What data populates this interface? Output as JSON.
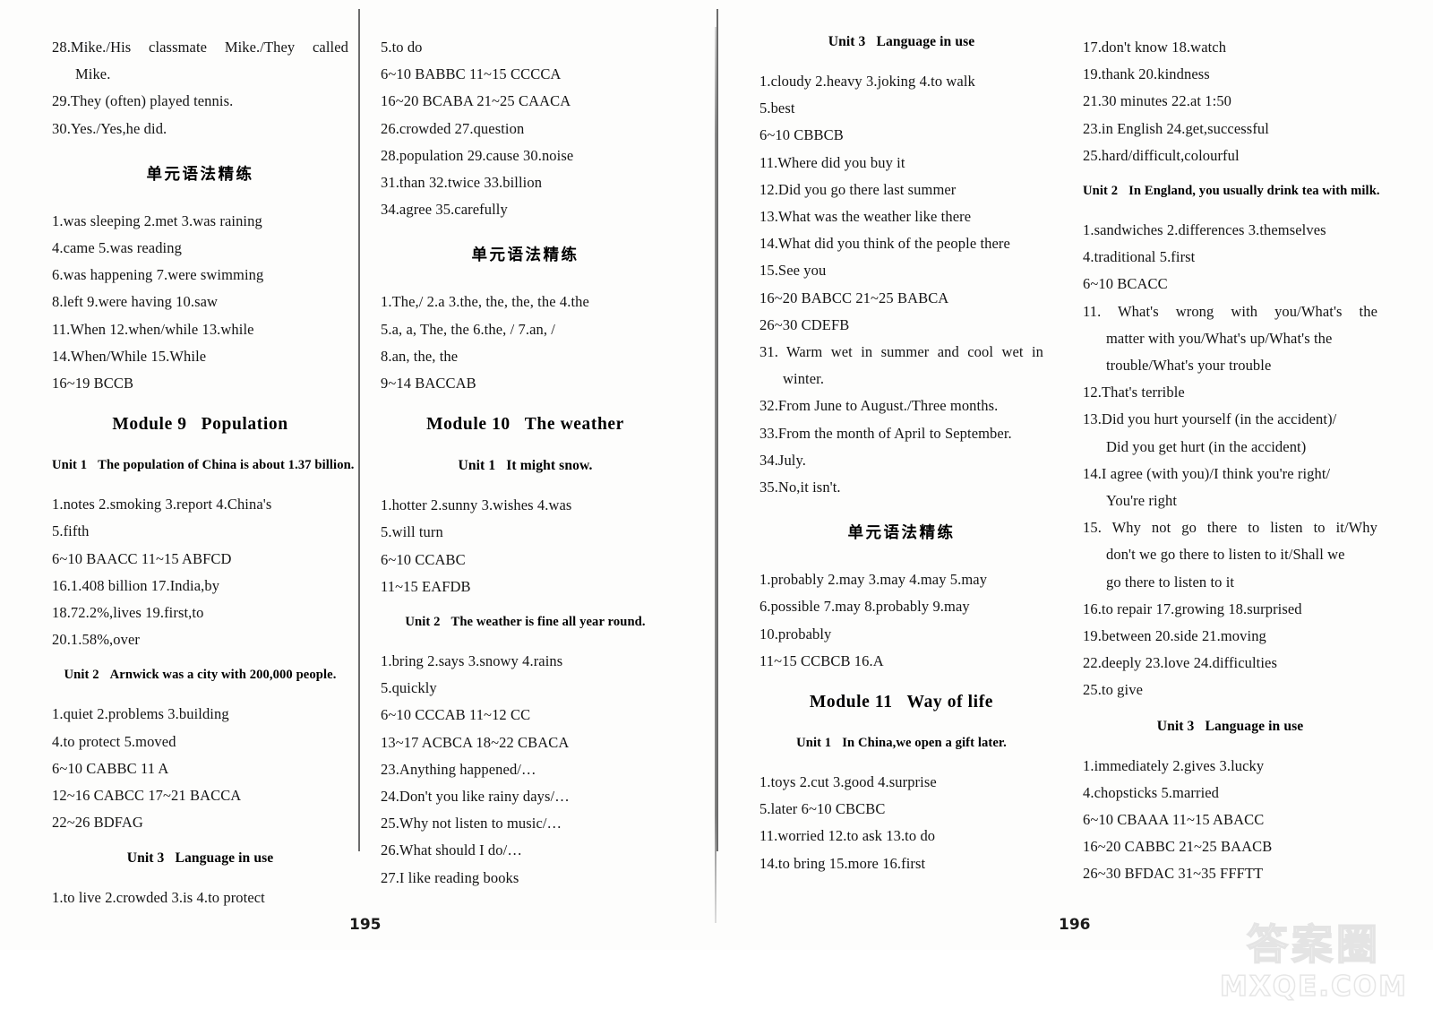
{
  "document": {
    "type": "answer-key-book-spread",
    "watermark_cjk": "答案圈",
    "watermark_domain": "MXQE.COM",
    "folio_left": "195",
    "folio_right": "196"
  },
  "col1": {
    "lines": [
      "28.Mike./His  classmate  Mike./They  called",
      "Mike.",
      "29.They (often) played tennis.",
      "30.Yes./Yes,he did."
    ],
    "grammar_head": "单元语法精练",
    "grammar_lines": [
      "1.was sleeping   2.met   3.was raining",
      "4.came   5.was reading",
      "6.was happening   7.were swimming",
      "8.left   9.were having   10.saw",
      "11.When   12.when/while   13.while",
      "14.When/While   15.While",
      "16~19   BCCB"
    ],
    "module": {
      "number": "Module 9",
      "title": "Population"
    },
    "unit1": {
      "label": "Unit 1",
      "title": "The population of China is about 1.37 billion.",
      "lines": [
        "1.notes  2.smoking  3.report  4.China's",
        "5.fifth",
        "6~10  BAACC  11~15  ABFCD",
        "16.1.408 billion  17.India,by",
        "18.72.2%,lives  19.first,to",
        "20.1.58%,over"
      ]
    },
    "unit2": {
      "label": "Unit 2",
      "title": "Arnwick was a city with 200,000 people.",
      "lines": [
        "1.quiet   2.problems   3.building",
        "4.to protect   5.moved",
        "6~10   CABBC   11 A",
        "12~16   CABCC   17~21   BACCA",
        "22~26   BDFAG"
      ]
    },
    "unit3": {
      "label": "Unit 3",
      "title": "Language in use",
      "lines": [
        "1.to live  2.crowded  3.is  4.to protect"
      ]
    }
  },
  "col2": {
    "lines": [
      "5.to do",
      "6~10   BABBC   11~15   CCCCA",
      "16~20   BCABA   21~25   CAACA",
      "26.crowded   27.question",
      "28.population   29.cause   30.noise",
      "31.than   32.twice   33.billion",
      "34.agree   35.carefully"
    ],
    "grammar_head": "单元语法精练",
    "grammar_lines": [
      "1.The,/  2.a  3.the, the, the, the  4.the",
      "5.a, a, The, the  6.the, /  7.an, /",
      "8.an, the, the",
      "9~14  BACCAB"
    ],
    "module": {
      "number": "Module 10",
      "title": "The weather"
    },
    "unit1": {
      "label": "Unit 1",
      "title": "It might snow.",
      "lines": [
        "1.hotter   2.sunny   3.wishes   4.was",
        "5.will turn",
        "6~10   CCABC",
        "11~15   EAFDB"
      ]
    },
    "unit2": {
      "label": "Unit 2",
      "title": "The weather is fine all year round.",
      "lines": [
        "1.bring   2.says   3.snowy   4.rains",
        "5.quickly",
        "6~10   CCCAB   11~12   CC",
        "13~17   ACBCA   18~22   CBACA",
        "23.Anything happened/…",
        "24.Don't you like rainy days/…",
        "25.Why not listen to music/…",
        "26.What should I do/…",
        "27.I like reading books"
      ]
    }
  },
  "col3": {
    "unit3": {
      "label": "Unit 3",
      "title": "Language in use",
      "lines": [
        "1.cloudy   2.heavy   3.joking   4.to walk",
        "5.best",
        "6~10   CBBCB",
        "11.Where did you buy it",
        "12.Did you go there last summer",
        "13.What was the weather like there",
        "14.What did you think of the people there",
        "15.See you",
        "16~20   BABCC   21~25   BABCA",
        "26~30   CDEFB",
        "31. Warm  wet  in  summer  and  cool  wet  in",
        "winter.",
        "32.From June to August./Three months.",
        "33.From the month of April to September.",
        "34.July.",
        "35.No,it isn't."
      ]
    },
    "grammar_head": "单元语法精练",
    "grammar_lines": [
      "1.probably   2.may   3.may   4.may   5.may",
      "6.possible   7.may   8.probably   9.may",
      "10.probably",
      "11~15   CCBCB   16.A"
    ],
    "module": {
      "number": "Module 11",
      "title": "Way of life"
    },
    "unit1": {
      "label": "Unit 1",
      "title": "In China,we open a gift later.",
      "lines": [
        "1.toys   2.cut   3.good   4.surprise",
        "5.later   6~10   CBCBC",
        "11.worried   12.to ask   13.to do",
        "14.to bring   15.more   16.first"
      ]
    }
  },
  "col4": {
    "lines": [
      "17.don't know   18.watch",
      "19.thank   20.kindness",
      "21.30 minutes   22.at 1:50",
      "23.in English   24.get,successful",
      "25.hard/difficult,colourful"
    ],
    "unit2": {
      "label": "Unit 2",
      "title": "In England, you usually drink tea with milk.",
      "lines": [
        "1.sandwiches   2.differences   3.themselves",
        "4.traditional   5.first",
        "6~10   BCACC",
        "11. What's  wrong  with  you/What's  the",
        "matter with you/What's up/What's the",
        "trouble/What's your trouble",
        "12.That's terrible",
        "13.Did you hurt yourself (in the accident)/",
        "Did you get hurt (in the accident)",
        "14.I agree (with you)/I think you're right/",
        "You're right",
        "15. Why  not  go  there  to  listen  to  it/Why",
        "don't we go there to listen to it/Shall we",
        "go there to listen to it",
        "16.to repair   17.growing   18.surprised",
        "19.between   20.side   21.moving",
        "22.deeply   23.love   24.difficulties",
        "25.to give"
      ]
    },
    "unit3": {
      "label": "Unit 3",
      "title": "Language in use",
      "lines": [
        "1.immediately   2.gives   3.lucky",
        "4.chopsticks   5.married",
        "6~10   CBAAA   11~15   ABACC",
        "16~20   CABBC   21~25   BAACB",
        "26~30   BFDAC   31~35   FFFTT"
      ]
    }
  }
}
